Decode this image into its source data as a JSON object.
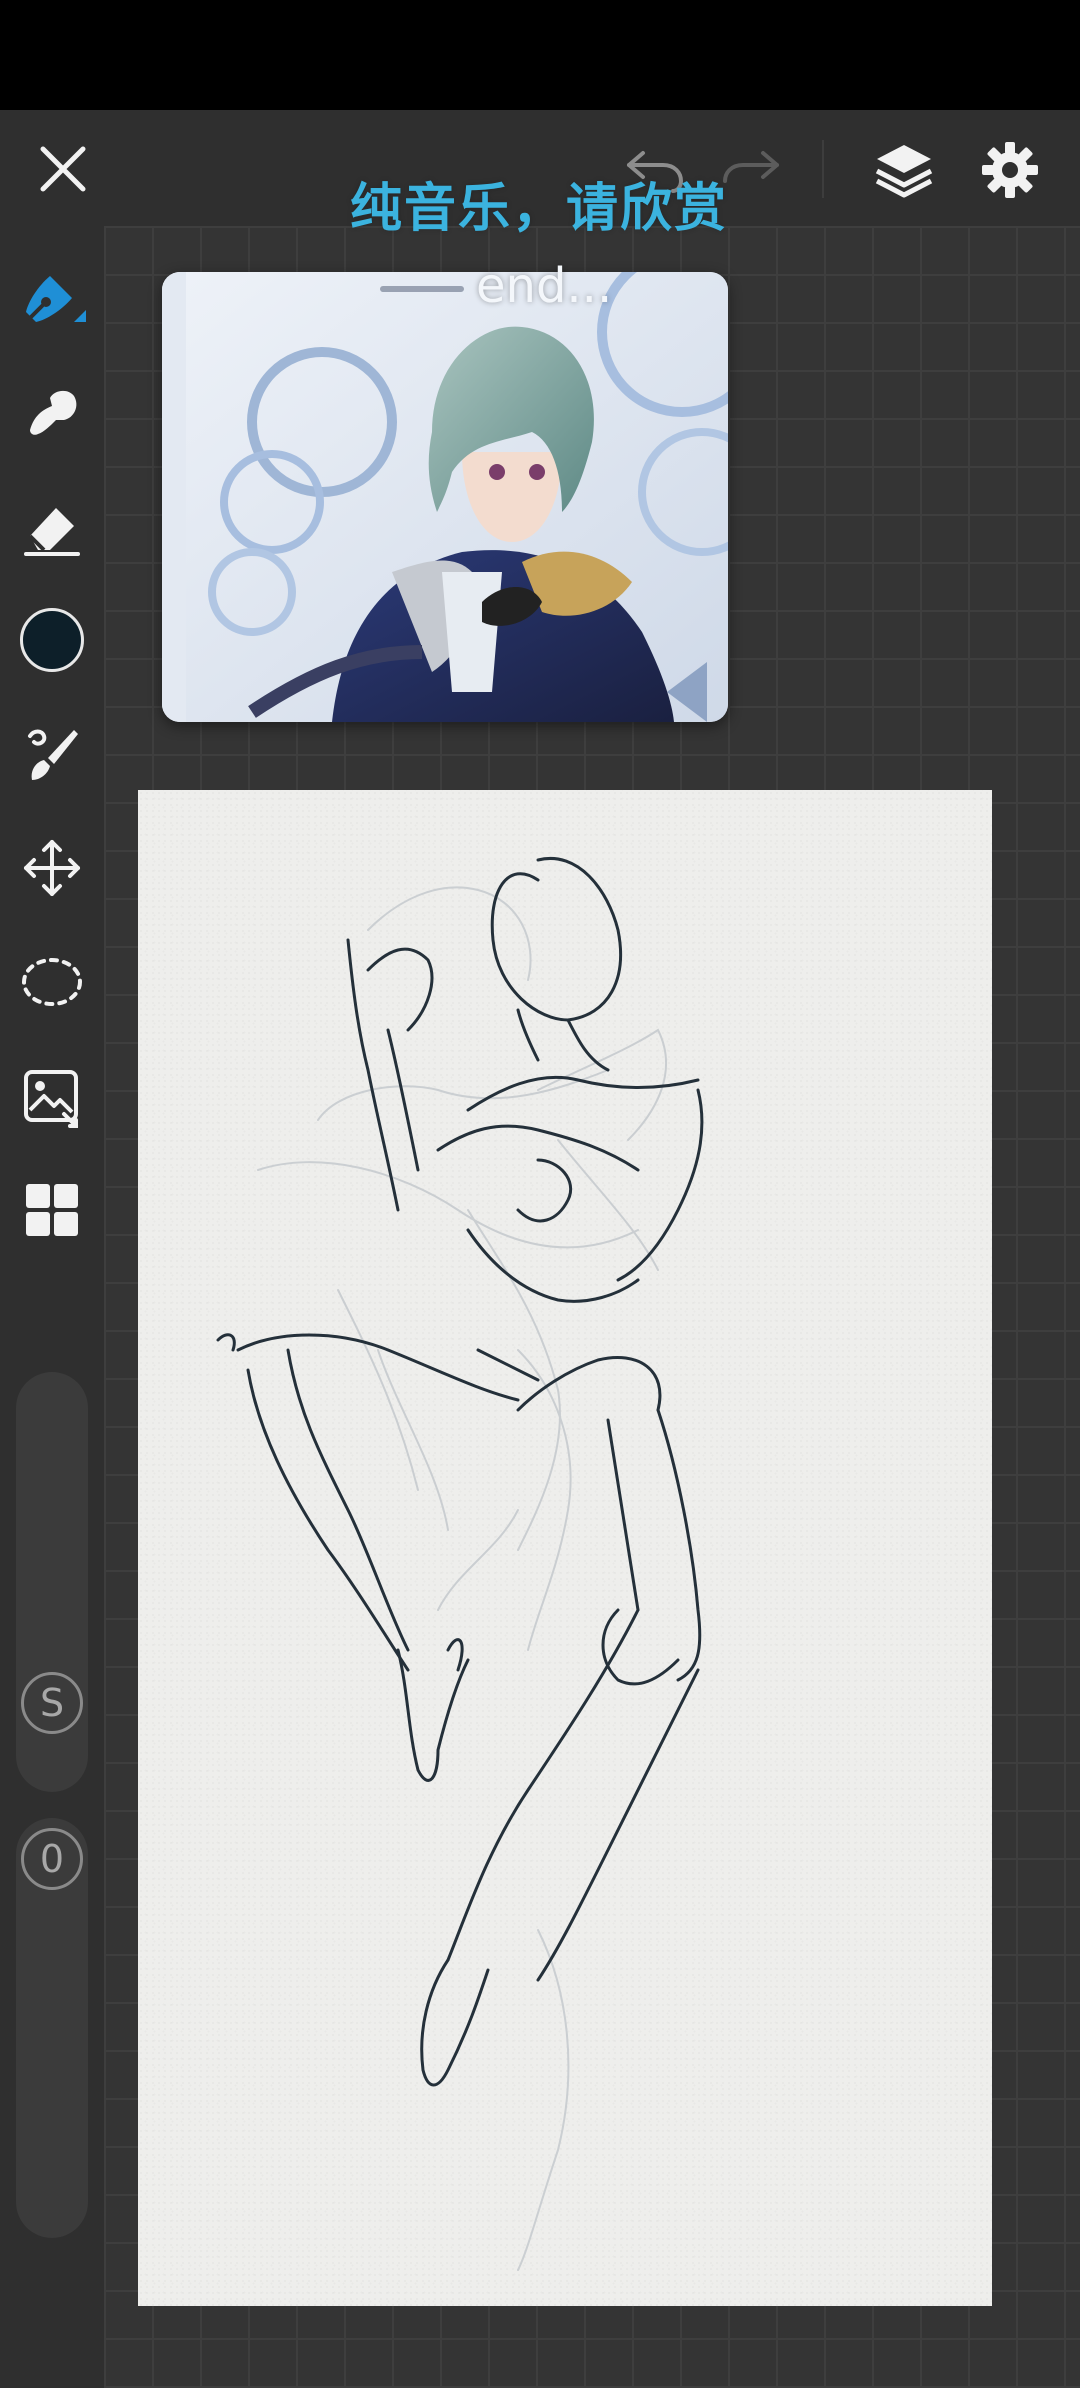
{
  "app": {
    "accent_color": "#1f8fd6",
    "background_color": "#2f2f2f"
  },
  "topbar": {
    "close_icon": "close-icon",
    "undo_icon": "undo-icon",
    "redo_icon": "redo-icon",
    "layers_icon": "layers-icon",
    "settings_icon": "gear-icon"
  },
  "toolbar": {
    "tools": [
      {
        "name": "pen",
        "icon": "pen-icon",
        "selected": true
      },
      {
        "name": "smudge",
        "icon": "smudge-icon",
        "selected": false
      },
      {
        "name": "eraser",
        "icon": "eraser-icon",
        "selected": false
      },
      {
        "name": "color",
        "icon": "color-swatch",
        "color": "#0d1f29",
        "selected": false
      },
      {
        "name": "brush",
        "icon": "brush-icon",
        "selected": false
      },
      {
        "name": "transform",
        "icon": "move-icon",
        "selected": false
      },
      {
        "name": "lasso",
        "icon": "lasso-icon",
        "selected": false
      },
      {
        "name": "image",
        "icon": "image-import-icon",
        "selected": false
      },
      {
        "name": "more",
        "icon": "grid-icon",
        "selected": false
      }
    ],
    "size_slider": {
      "knob_label": "S"
    },
    "opacity_slider": {
      "knob_label": "0"
    }
  },
  "overlay": {
    "caption": "纯音乐，请欣赏",
    "subcaption": "end..."
  },
  "reference": {
    "label": "reference-image"
  }
}
